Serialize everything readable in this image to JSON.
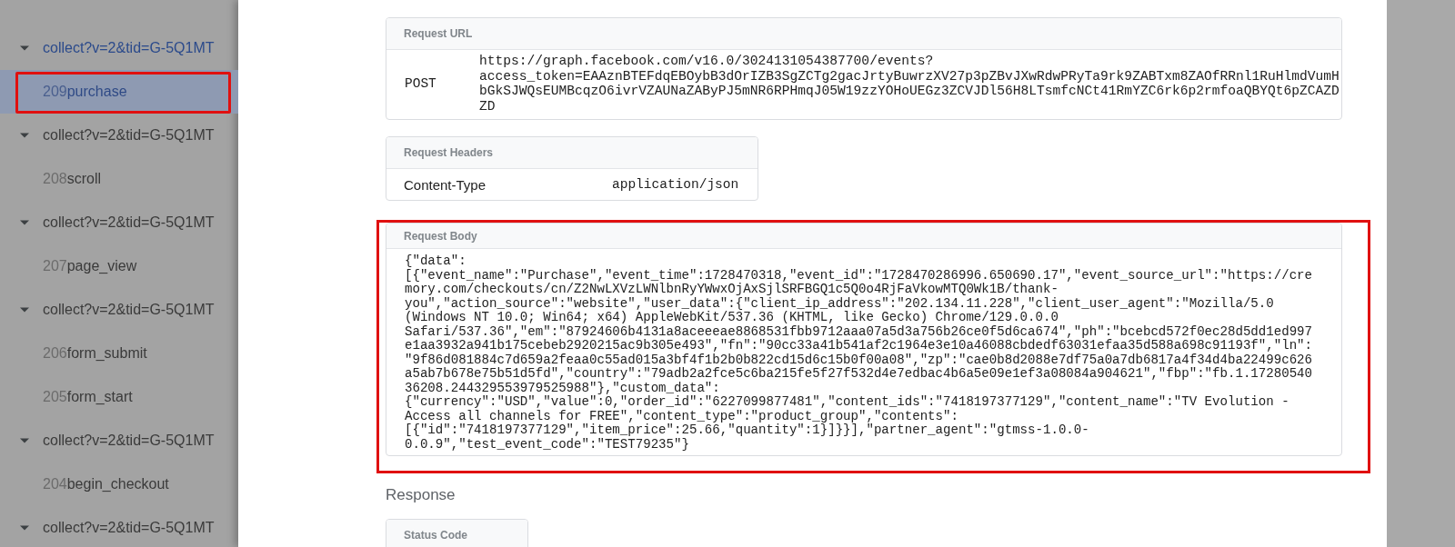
{
  "sidebar": {
    "items": [
      {
        "kind": "group",
        "label": "collect?v=2&tid=G-5Q1MT",
        "expanded": true,
        "active": true
      },
      {
        "kind": "event",
        "number": "209",
        "name": "purchase",
        "selected": true,
        "highlighted": true
      },
      {
        "kind": "group",
        "label": "collect?v=2&tid=G-5Q1MT",
        "expanded": true,
        "active": false
      },
      {
        "kind": "event",
        "number": "208",
        "name": "scroll",
        "selected": false,
        "highlighted": false
      },
      {
        "kind": "group",
        "label": "collect?v=2&tid=G-5Q1MT",
        "expanded": true,
        "active": false
      },
      {
        "kind": "event",
        "number": "207",
        "name": "page_view",
        "selected": false,
        "highlighted": false
      },
      {
        "kind": "group",
        "label": "collect?v=2&tid=G-5Q1MT",
        "expanded": true,
        "active": false
      },
      {
        "kind": "event",
        "number": "206",
        "name": "form_submit",
        "selected": false,
        "highlighted": false
      },
      {
        "kind": "event",
        "number": "205",
        "name": "form_start",
        "selected": false,
        "highlighted": false
      },
      {
        "kind": "group",
        "label": "collect?v=2&tid=G-5Q1MT",
        "expanded": true,
        "active": false
      },
      {
        "kind": "event",
        "number": "204",
        "name": "begin_checkout",
        "selected": false,
        "highlighted": false
      },
      {
        "kind": "group",
        "label": "collect?v=2&tid=G-5Q1MT",
        "expanded": true,
        "active": false
      }
    ]
  },
  "request": {
    "url": {
      "title": "Request URL",
      "method": "POST",
      "lines": [
        "https://graph.facebook.com/v16.0/3024131054387700/events?",
        "access_token=EAAznBTEFdqEBOybB3dOrIZB3SgZCTg2gacJrtyBuwrzXV27p3pZBvJXwRdwPRyTa9rk9ZABTxm8ZAOfRRnl1RuHlmdVumH",
        "bGkSJWQsEUMBcqzO6ivrVZAUNaZAByPJ5mNR6RPHmqJ05W19zzYOHoUEGz3ZCVJDl56H8LTsmfcNCt41RmYZC6rk6p2rmfoaQBYQt6pZCAZD",
        "ZD"
      ]
    },
    "headers": {
      "title": "Request Headers",
      "rows": [
        {
          "name": "Content-Type",
          "value": "application/json"
        }
      ]
    },
    "body": {
      "title": "Request Body",
      "highlighted": true,
      "lines": [
        "{\"data\":",
        "[{\"event_name\":\"Purchase\",\"event_time\":1728470318,\"event_id\":\"1728470286996.650690.17\",\"event_source_url\":\"https://cre",
        "mory.com/checkouts/cn/Z2NwLXVzLWNlbnRyYWwxOjAxSjlSRFBGQ1c5Q0o4RjFaVkowMTQ0Wk1B/thank-",
        "you\",\"action_source\":\"website\",\"user_data\":{\"client_ip_address\":\"202.134.11.228\",\"client_user_agent\":\"Mozilla/5.0",
        "(Windows NT 10.0; Win64; x64) AppleWebKit/537.36 (KHTML, like Gecko) Chrome/129.0.0.0",
        "Safari/537.36\",\"em\":\"87924606b4131a8aceeeae8868531fbb9712aaa07a5d3a756b26ce0f5d6ca674\",\"ph\":\"bcebcd572f0ec28d5dd1ed997",
        "e1aa3932a941b175cebeb2920215ac9b305e493\",\"fn\":\"90cc33a41b541af2c1964e3e10a46088cbdedf63031efaa35d588a698c91193f\",\"ln\":",
        "\"9f86d081884c7d659a2feaa0c55ad015a3bf4f1b2b0b822cd15d6c15b0f00a08\",\"zp\":\"cae0b8d2088e7df75a0a7db6817a4f34d4ba22499c626",
        "a5ab7b678e75b51d5fd\",\"country\":\"79adb2a2fce5c6ba215fe5f27f532d4e7edbac4b6a5e09e1ef3a08084a904621\",\"fbp\":\"fb.1.17280540",
        "36208.244329553979525988\"},\"custom_data\":",
        "{\"currency\":\"USD\",\"value\":0,\"order_id\":\"6227099877481\",\"content_ids\":\"7418197377129\",\"content_name\":\"TV Evolution -",
        "Access all channels for FREE\",\"content_type\":\"product_group\",\"contents\":",
        "[{\"id\":\"7418197377129\",\"item_price\":25.66,\"quantity\":1}]}}],\"partner_agent\":\"gtmss-1.0.0-",
        "0.0.9\",\"test_event_code\":\"TEST79235\"}"
      ]
    }
  },
  "response": {
    "title": "Response",
    "status_code": {
      "title": "Status Code"
    }
  }
}
